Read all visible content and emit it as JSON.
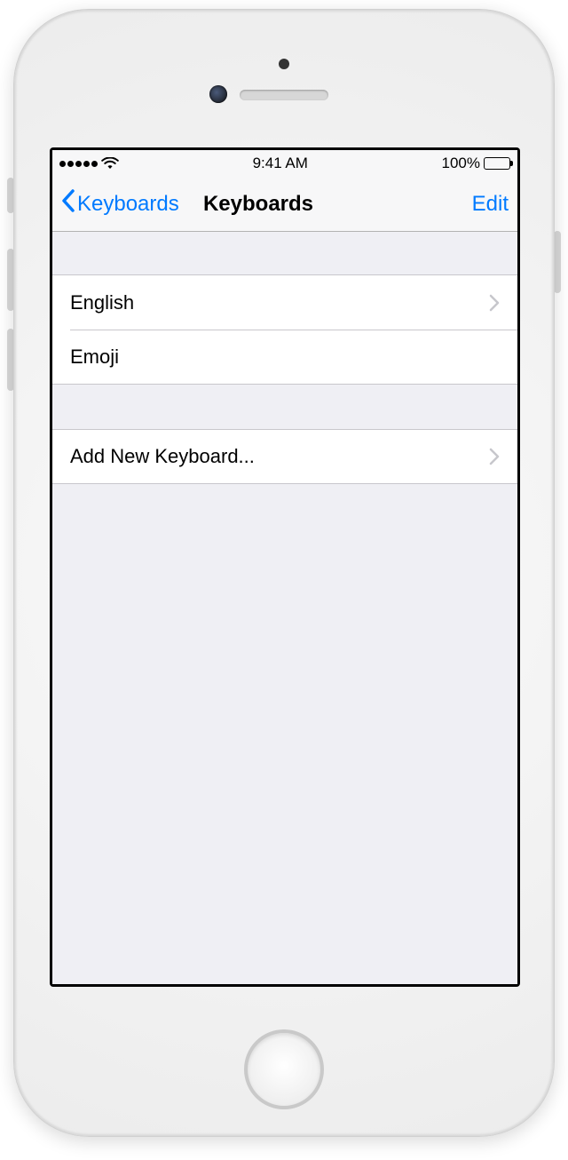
{
  "status": {
    "time": "9:41 AM",
    "battery_pct": "100%"
  },
  "nav": {
    "back_label": "Keyboards",
    "title": "Keyboards",
    "edit_label": "Edit"
  },
  "keyboards": [
    {
      "label": "English",
      "disclosure": true
    },
    {
      "label": "Emoji",
      "disclosure": false
    }
  ],
  "add_label": "Add New Keyboard..."
}
